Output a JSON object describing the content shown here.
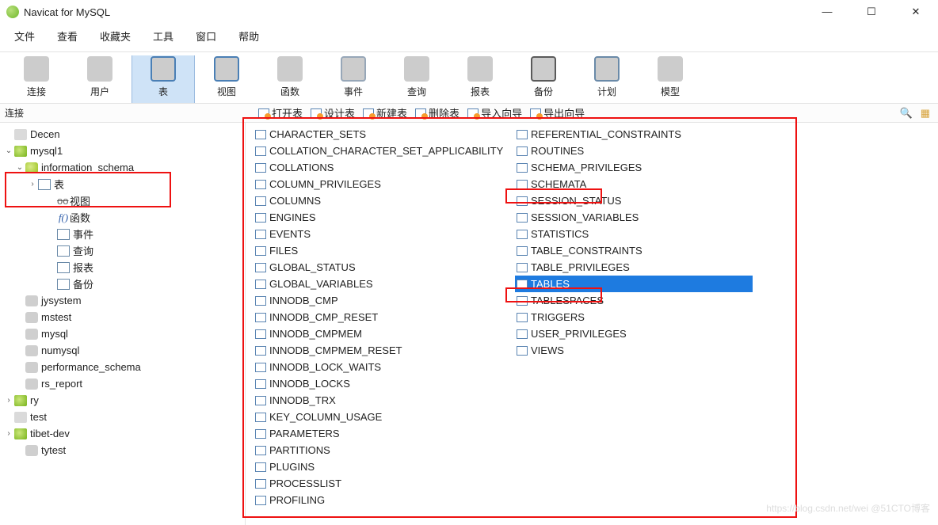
{
  "titlebar": {
    "title": "Navicat for MySQL"
  },
  "menu": {
    "items": [
      "文件",
      "查看",
      "收藏夹",
      "工具",
      "窗口",
      "帮助"
    ]
  },
  "toolbar": {
    "items": [
      {
        "label": "连接",
        "icon": "ic-conn",
        "active": false,
        "name": "tool-connect"
      },
      {
        "label": "用户",
        "icon": "ic-user",
        "active": false,
        "name": "tool-user"
      },
      {
        "label": "表",
        "icon": "ic-table",
        "active": true,
        "name": "tool-table"
      },
      {
        "label": "视图",
        "icon": "ic-view",
        "active": false,
        "name": "tool-view"
      },
      {
        "label": "函数",
        "icon": "ic-func",
        "active": false,
        "name": "tool-function"
      },
      {
        "label": "事件",
        "icon": "ic-event",
        "active": false,
        "name": "tool-event"
      },
      {
        "label": "查询",
        "icon": "ic-query",
        "active": false,
        "name": "tool-query"
      },
      {
        "label": "报表",
        "icon": "ic-report",
        "active": false,
        "name": "tool-report"
      },
      {
        "label": "备份",
        "icon": "ic-backup",
        "active": false,
        "name": "tool-backup"
      },
      {
        "label": "计划",
        "icon": "ic-plan",
        "active": false,
        "name": "tool-schedule"
      },
      {
        "label": "模型",
        "icon": "ic-model",
        "active": false,
        "name": "tool-model"
      }
    ]
  },
  "subheader": {
    "left_label": "连接",
    "tools": [
      "打开表",
      "设计表",
      "新建表",
      "删除表",
      "导入向导",
      "导出向导"
    ]
  },
  "sidebar": {
    "rows": [
      {
        "lvl": "lvl0",
        "twist": "",
        "icon": "ti-conn-off",
        "label": "Decen",
        "name": "conn-decen"
      },
      {
        "lvl": "lvl0",
        "twist": "v",
        "icon": "ti-conn-on",
        "label": "mysql1",
        "name": "conn-mysql1"
      },
      {
        "lvl": "lvl1",
        "twist": "v",
        "icon": "ti-db",
        "label": "information_schema",
        "name": "db-information-schema"
      },
      {
        "lvl": "lvl2",
        "twist": ">",
        "icon": "ti-tiny",
        "label": "表",
        "name": "node-tables"
      },
      {
        "lvl": "lvl3",
        "twist": "",
        "icon": "strike",
        "label": "视图",
        "name": "node-views"
      },
      {
        "lvl": "lvl3",
        "twist": "",
        "icon": "fo",
        "label": "函数",
        "name": "node-functions"
      },
      {
        "lvl": "lvl3",
        "twist": "",
        "icon": "ti-tiny",
        "label": "事件",
        "name": "node-events"
      },
      {
        "lvl": "lvl3",
        "twist": "",
        "icon": "ti-tiny",
        "label": "查询",
        "name": "node-queries"
      },
      {
        "lvl": "lvl3",
        "twist": "",
        "icon": "ti-tiny",
        "label": "报表",
        "name": "node-reports"
      },
      {
        "lvl": "lvl3",
        "twist": "",
        "icon": "ti-tiny",
        "label": "备份",
        "name": "node-backups"
      },
      {
        "lvl": "lvl1",
        "twist": "",
        "icon": "ti-db-off",
        "label": "jysystem",
        "name": "db-jysystem"
      },
      {
        "lvl": "lvl1",
        "twist": "",
        "icon": "ti-db-off",
        "label": "mstest",
        "name": "db-mstest"
      },
      {
        "lvl": "lvl1",
        "twist": "",
        "icon": "ti-db-off",
        "label": "mysql",
        "name": "db-mysql"
      },
      {
        "lvl": "lvl1",
        "twist": "",
        "icon": "ti-db-off",
        "label": "numysql",
        "name": "db-numysql"
      },
      {
        "lvl": "lvl1",
        "twist": "",
        "icon": "ti-db-off",
        "label": "performance_schema",
        "name": "db-performance-schema"
      },
      {
        "lvl": "lvl1",
        "twist": "",
        "icon": "ti-db-off",
        "label": "rs_report",
        "name": "db-rs-report"
      },
      {
        "lvl": "lvl0",
        "twist": ">",
        "icon": "ti-conn-on",
        "label": "ry",
        "name": "conn-ry"
      },
      {
        "lvl": "lvl0",
        "twist": "",
        "icon": "ti-conn-off",
        "label": "test",
        "name": "conn-test"
      },
      {
        "lvl": "lvl0",
        "twist": ">",
        "icon": "ti-conn-on",
        "label": "tibet-dev",
        "name": "conn-tibet-dev"
      },
      {
        "lvl": "lvl1",
        "twist": "",
        "icon": "ti-db-off",
        "label": "tytest",
        "name": "db-tytest"
      }
    ]
  },
  "tables": {
    "col1": [
      "CHARACTER_SETS",
      "COLLATION_CHARACTER_SET_APPLICABILITY",
      "COLLATIONS",
      "COLUMN_PRIVILEGES",
      "COLUMNS",
      "ENGINES",
      "EVENTS",
      "FILES",
      "GLOBAL_STATUS",
      "GLOBAL_VARIABLES",
      "INNODB_CMP",
      "INNODB_CMP_RESET",
      "INNODB_CMPMEM",
      "INNODB_CMPMEM_RESET",
      "INNODB_LOCK_WAITS",
      "INNODB_LOCKS",
      "INNODB_TRX",
      "KEY_COLUMN_USAGE",
      "PARAMETERS",
      "PARTITIONS",
      "PLUGINS",
      "PROCESSLIST",
      "PROFILING"
    ],
    "col2": [
      {
        "label": "REFERENTIAL_CONSTRAINTS",
        "sel": false
      },
      {
        "label": "ROUTINES",
        "sel": false
      },
      {
        "label": "SCHEMA_PRIVILEGES",
        "sel": false
      },
      {
        "label": "SCHEMATA",
        "sel": false
      },
      {
        "label": "SESSION_STATUS",
        "sel": false
      },
      {
        "label": "SESSION_VARIABLES",
        "sel": false
      },
      {
        "label": "STATISTICS",
        "sel": false
      },
      {
        "label": "TABLE_CONSTRAINTS",
        "sel": false
      },
      {
        "label": "TABLE_PRIVILEGES",
        "sel": false
      },
      {
        "label": "TABLES",
        "sel": true
      },
      {
        "label": "TABLESPACES",
        "sel": false
      },
      {
        "label": "TRIGGERS",
        "sel": false
      },
      {
        "label": "USER_PRIVILEGES",
        "sel": false
      },
      {
        "label": "VIEWS",
        "sel": false
      }
    ]
  },
  "watermark": "https://blog.csdn.net/wei @51CTO博客"
}
